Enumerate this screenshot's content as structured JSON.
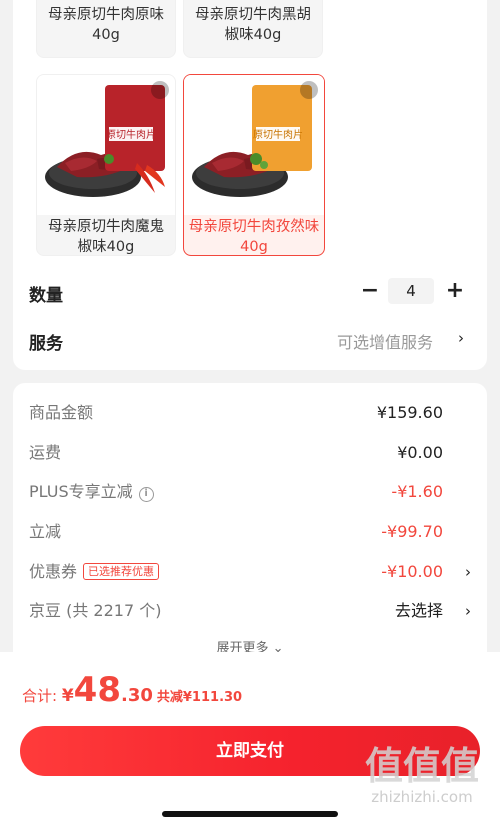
{
  "variants": [
    {
      "label": "母亲原切牛肉原味40g",
      "selected": false
    },
    {
      "label": "母亲原切牛肉黑胡椒味40g",
      "selected": false
    },
    {
      "label": "母亲原切牛肉魔鬼椒味40g",
      "selected": false,
      "package_color": "#b8232a",
      "package_text": "原切牛肉片"
    },
    {
      "label": "母亲原切牛肉孜然味40g",
      "selected": true,
      "package_color": "#f0a030",
      "package_text": "原切牛肉片"
    }
  ],
  "quantity": {
    "label": "数量",
    "value": "4",
    "minus": "−",
    "plus": "+"
  },
  "service": {
    "label": "服务",
    "value": "可选增值服务",
    "chevron": "›"
  },
  "costs": {
    "goods_amount": {
      "label": "商品金额",
      "value": "¥159.60"
    },
    "shipping": {
      "label": "运费",
      "value": "¥0.00"
    },
    "plus_discount": {
      "label": "PLUS专享立减",
      "info_icon": "i",
      "value": "-¥1.60"
    },
    "instant_discount": {
      "label": "立减",
      "value": "-¥99.70"
    },
    "coupon": {
      "label": "优惠券",
      "badge": "已选推荐优惠",
      "value": "-¥10.00",
      "chevron": "›"
    },
    "jingdou": {
      "label": "京豆 (共 2217 个)",
      "value": "去选择",
      "chevron": "›"
    },
    "expand_more": "展开更多 ⌄"
  },
  "total": {
    "label": "合计: ",
    "currency": "¥",
    "integer": "48",
    "decimal": ".30",
    "saved": "共减¥111.30"
  },
  "pay_button": "立即支付",
  "watermark": {
    "mark": "值值值",
    "url": "zhizhizhi.com"
  },
  "colors": {
    "accent": "#f2473d",
    "background": "#f2f2f2"
  }
}
